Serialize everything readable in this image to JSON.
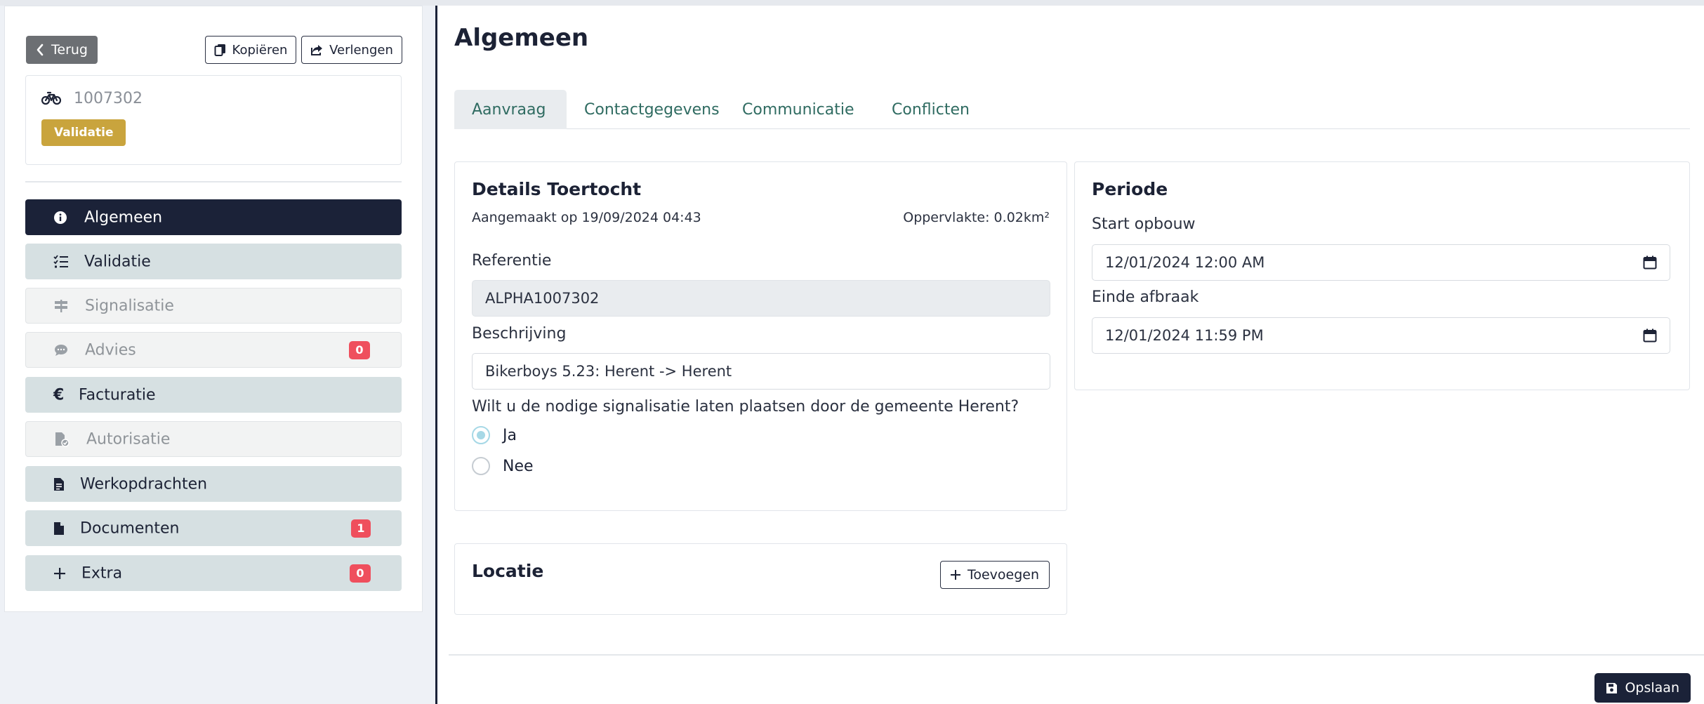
{
  "header": {
    "back_label": "Terug",
    "copy_label": "Kopiëren",
    "extend_label": "Verlengen"
  },
  "record": {
    "id": "1007302",
    "status": "Validatie",
    "status_color": "#c9a43d"
  },
  "sidebar": {
    "items": [
      {
        "label": "Algemeen",
        "icon": "info-circle-icon",
        "state": "active"
      },
      {
        "label": "Validatie",
        "icon": "checklist-icon",
        "state": "normal"
      },
      {
        "label": "Signalisatie",
        "icon": "signpost-icon",
        "state": "disabled"
      },
      {
        "label": "Advies",
        "icon": "chat-icon",
        "state": "disabled",
        "count": "0"
      },
      {
        "label": "Facturatie",
        "icon": "euro-icon",
        "state": "normal"
      },
      {
        "label": "Autorisatie",
        "icon": "file-check-icon",
        "state": "disabled"
      },
      {
        "label": "Werkopdrachten",
        "icon": "file-text-icon",
        "state": "normal"
      },
      {
        "label": "Documenten",
        "icon": "file-icon",
        "state": "normal",
        "count": "1"
      },
      {
        "label": "Extra",
        "icon": "plus-icon",
        "state": "normal",
        "count": "0"
      }
    ]
  },
  "main": {
    "title": "Algemeen",
    "tabs": [
      {
        "label": "Aanvraag",
        "active": true
      },
      {
        "label": "Contactgegevens",
        "active": false
      },
      {
        "label": "Communicatie",
        "active": false
      },
      {
        "label": "Conflicten",
        "active": false
      }
    ],
    "details": {
      "title": "Details Toertocht",
      "created": "Aangemaakt op 19/09/2024 04:43",
      "area": "Oppervlakte: 0.02km²",
      "reference_label": "Referentie",
      "reference_value": "ALPHA1007302",
      "description_label": "Beschrijving",
      "description_value": "Bikerboys 5.23: Herent -> Herent",
      "question": "Wilt u de nodige signalisatie laten plaatsen door de gemeente Herent?",
      "options": [
        {
          "label": "Ja",
          "selected": true
        },
        {
          "label": "Nee",
          "selected": false
        }
      ]
    },
    "periode": {
      "title": "Periode",
      "start_label": "Start opbouw",
      "start_value": "12/01/2024 12:00 AM",
      "end_label": "Einde afbraak",
      "end_value": "12/01/2024 11:59 PM"
    },
    "locatie": {
      "title": "Locatie",
      "add_label": "Toevoegen"
    },
    "save_label": "Opslaan"
  },
  "colors": {
    "primary_dark": "#1b2238",
    "nav_normal": "#d6e0e2",
    "badge_red": "#ef4f5d",
    "tab_text": "#2f6b61"
  }
}
